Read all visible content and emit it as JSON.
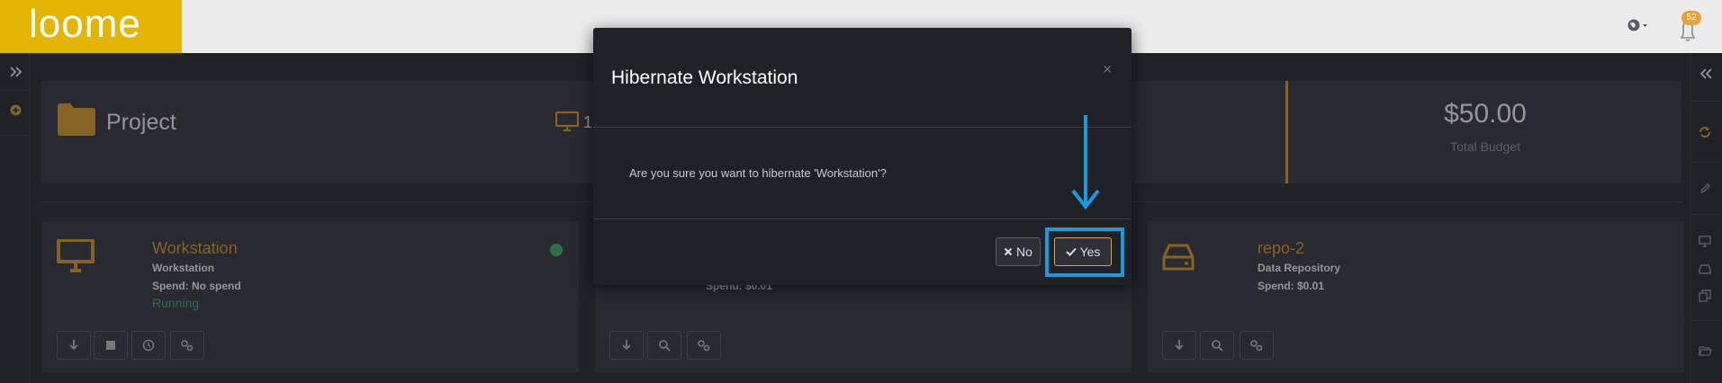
{
  "brand": {
    "logo_text": "loome",
    "accent": "#e3b505"
  },
  "topbar": {
    "notification_count": "52"
  },
  "header": {
    "project_title": "Project",
    "workstation_count": "1",
    "budget_value": "$50.00",
    "budget_label": "Total Budget"
  },
  "cards": [
    {
      "name": "Workstation",
      "type": "Workstation",
      "spend": "Spend: No spend",
      "status": "Running"
    },
    {
      "spend": "Spend: $0.01"
    },
    {
      "name": "repo-2",
      "type": "Data Repository",
      "spend": "Spend: $0.01"
    }
  ],
  "modal": {
    "title": "Hibernate Workstation",
    "close": "×",
    "body": "Are you sure you want to hibernate 'Workstation'?",
    "no_label": "No",
    "yes_label": "Yes"
  },
  "colors": {
    "highlight": "#1a9be0",
    "orange": "#e3a52d",
    "green": "#3fbf6f"
  }
}
